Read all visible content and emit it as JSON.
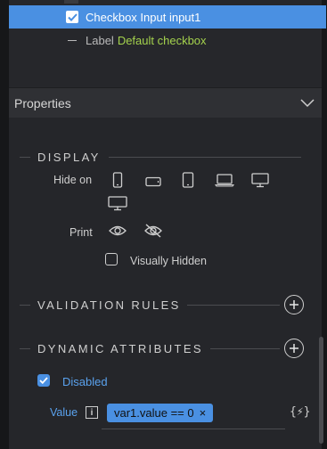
{
  "tree": {
    "selected_item": "Checkbox Input input1",
    "child_prefix": "Label",
    "child_value": "Default checkbox"
  },
  "properties": {
    "header": "Properties",
    "chevron_icon": "chevron-down-icon"
  },
  "display": {
    "title": "DISPLAY",
    "hide_on_label": "Hide on",
    "devices": [
      "mobile-portrait-icon",
      "mobile-landscape-icon",
      "tablet-icon",
      "laptop-icon",
      "desktop-icon",
      "wide-desktop-icon"
    ],
    "print_label": "Print",
    "print_icons": [
      "eye-icon",
      "eye-slash-icon"
    ],
    "visually_hidden_label": "Visually Hidden",
    "visually_hidden_checked": false
  },
  "validation": {
    "title": "VALIDATION RULES"
  },
  "dynamic": {
    "title": "DYNAMIC ATTRIBUTES",
    "disabled_label": "Disabled",
    "disabled_checked": true,
    "value_label": "Value",
    "value_expression": "var1.value == 0",
    "remove_symbol": "×",
    "code_icon_text": "{⚡}"
  },
  "colors": {
    "accent": "#4a90e2",
    "green": "#a4d24d",
    "background": "#25262a"
  }
}
